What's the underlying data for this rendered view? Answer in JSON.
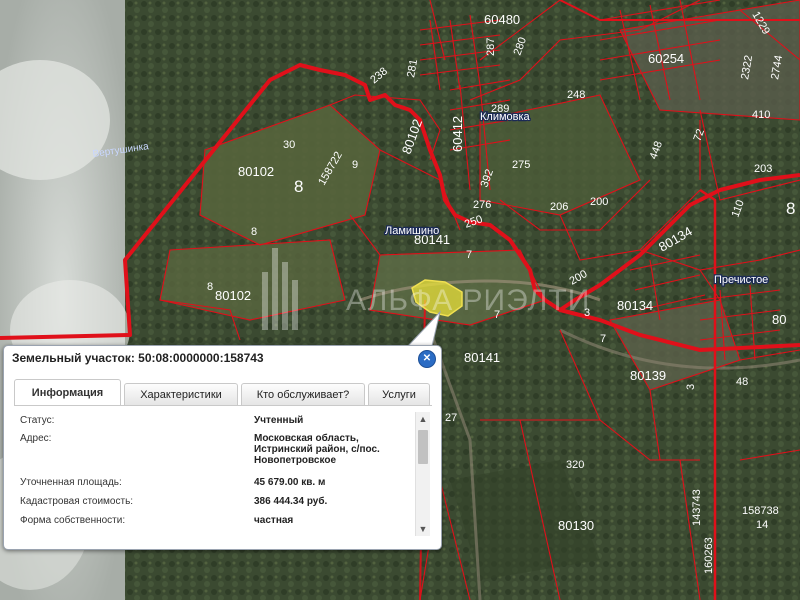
{
  "map": {
    "watermark": "АЛЬФА РИЭЛТИ",
    "places": [
      "Ламишино",
      "Климовка",
      "Пречистое"
    ],
    "water_labels": [
      "Вертушинка"
    ],
    "parcel_labels": {
      "big": [
        "8",
        "8"
      ],
      "medium": [
        "80102",
        "80102",
        "80141",
        "80141",
        "80134",
        "80139",
        "80130",
        "60480",
        "60254",
        "60412",
        "80102",
        "80134"
      ],
      "small": [
        "30",
        "9",
        "158722",
        "8",
        "8",
        "287",
        "280",
        "281",
        "238",
        "289",
        "248",
        "410",
        "275",
        "392",
        "276",
        "206",
        "200",
        "250",
        "7",
        "7",
        "200",
        "3",
        "7",
        "48",
        "3",
        "72",
        "448",
        "110",
        "203",
        "320",
        "27",
        "143743",
        "158738",
        "14",
        "160263",
        "1229",
        "2322",
        "2744",
        "80"
      ]
    }
  },
  "popup": {
    "title": "Земельный участок: 50:08:0000000:158743",
    "close_icon": "close-icon",
    "tabs": [
      {
        "label": "Информация",
        "active": true
      },
      {
        "label": "Характеристики",
        "active": false
      },
      {
        "label": "Кто обслуживает?",
        "active": false
      },
      {
        "label": "Услуги",
        "active": false
      }
    ],
    "rows": [
      {
        "label": "Статус:",
        "value": "Учтенный"
      },
      {
        "label": "Адрес:",
        "value": "Московская область, Истринский район, с/пос. Новопетровское"
      },
      {
        "label": "Уточненная площадь:",
        "value": "45 679.00 кв. м"
      },
      {
        "label": "Кадастровая стоимость:",
        "value": "386 444.34 руб."
      },
      {
        "label": "Форма собственности:",
        "value": "частная"
      }
    ]
  },
  "colors": {
    "boundary": "#e0101a",
    "highlight": "#e8e03a",
    "popup_accent": "#2b6cc4"
  }
}
